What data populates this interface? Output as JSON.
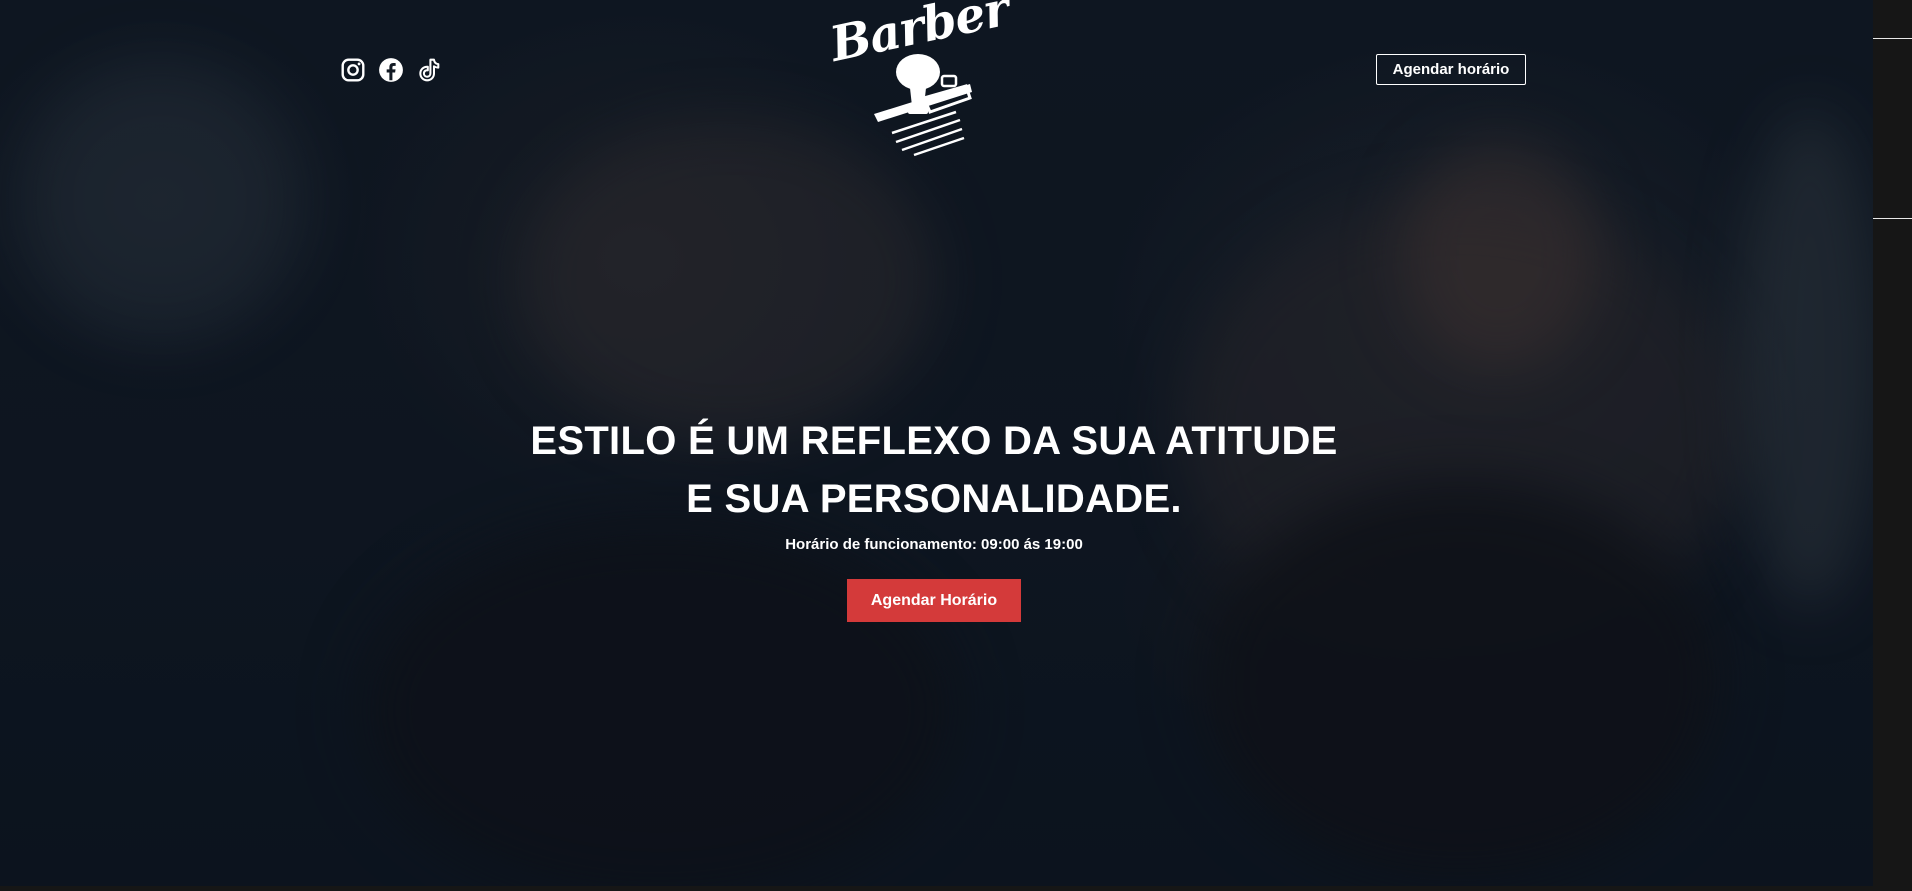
{
  "header": {
    "social_icons": [
      "instagram-icon",
      "facebook-icon",
      "tiktok-icon"
    ],
    "logo_text": "Barber",
    "schedule_button": "Agendar horário"
  },
  "hero": {
    "headline_line1": "ESTILO É UM REFLEXO DA SUA ATITUDE",
    "headline_line2": "E SUA PERSONALIDADE.",
    "hours": "Horário de funcionamento: 09:00 ás 19:00",
    "cta_button": "Agendar Horário"
  },
  "colors": {
    "accent": "#d43a3a",
    "overlay": "#111822",
    "text": "#ffffff"
  }
}
